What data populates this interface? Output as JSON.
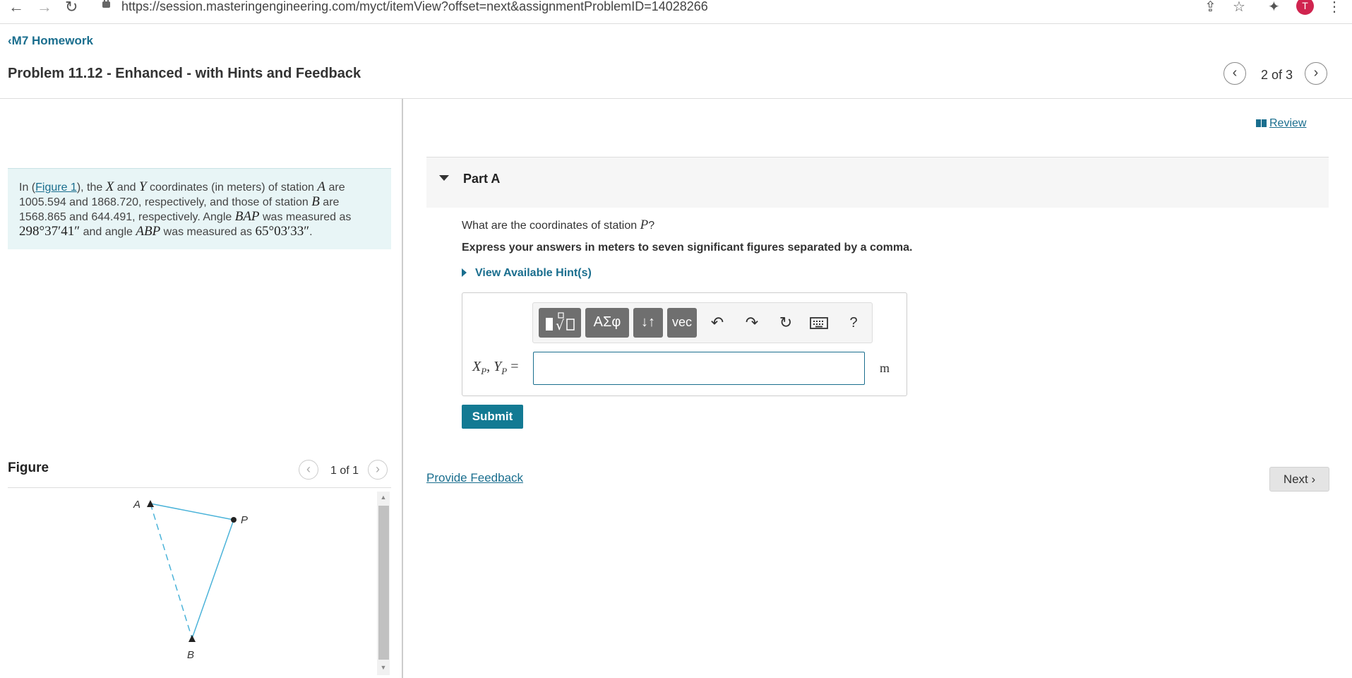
{
  "browser": {
    "url": "https://session.masteringengineering.com/myct/itemView?offset=next&assignmentProblemID=14028266",
    "avatar_letter": "T"
  },
  "nav": {
    "back_label": "M7 Homework"
  },
  "problem": {
    "title": "Problem 11.12 - Enhanced - with Hints and Feedback",
    "pager": "2 of 3"
  },
  "prompt": {
    "t1": "In (",
    "figure_link": "Figure 1",
    "t2": "), the ",
    "X": "X",
    "t3": " and ",
    "Y": "Y",
    "t4": " coordinates (in meters) of station ",
    "A": "A",
    "t5": " are 1005.594 and 1868.720, respectively, and those of station ",
    "B": "B",
    "t6": " are 1568.865 and 644.491, respectively. Angle ",
    "BAP": "BAP",
    "t7": " was measured as ",
    "angle1": "298°37′41″",
    "t8": " and angle ",
    "ABP": "ABP",
    "t9": " was measured as ",
    "angle2": "65°03′33″",
    "t10": "."
  },
  "figure": {
    "title": "Figure",
    "count": "1 of 1",
    "labels": {
      "A": "A",
      "P": "P",
      "B": "B"
    },
    "colors": {
      "line": "#4bb3d9",
      "marker": "#222"
    }
  },
  "review": {
    "label": "Review"
  },
  "part_a": {
    "label": "Part A",
    "question_pre": "What are the coordinates of station ",
    "question_var": "P",
    "question_post": "?",
    "instruction": "Express your answers in meters to seven significant figures separated by a comma.",
    "hint_label": "View Available Hint(s)",
    "toolbar": {
      "greek_label": "ΑΣφ",
      "arrows_label": "↓↑",
      "vec_label": "vec",
      "help_label": "?"
    },
    "answer": {
      "var_x": "X",
      "sub_x": "P",
      "sep": ", ",
      "var_y": "Y",
      "sub_y": "P",
      "equals": " =",
      "value": "",
      "unit": "m"
    },
    "submit_label": "Submit"
  },
  "footer": {
    "feedback_label": "Provide Feedback",
    "next_label": "Next"
  },
  "colors": {
    "accent": "#137a93",
    "link": "#1a6e8e",
    "prompt_bg": "#e8f5f6"
  }
}
